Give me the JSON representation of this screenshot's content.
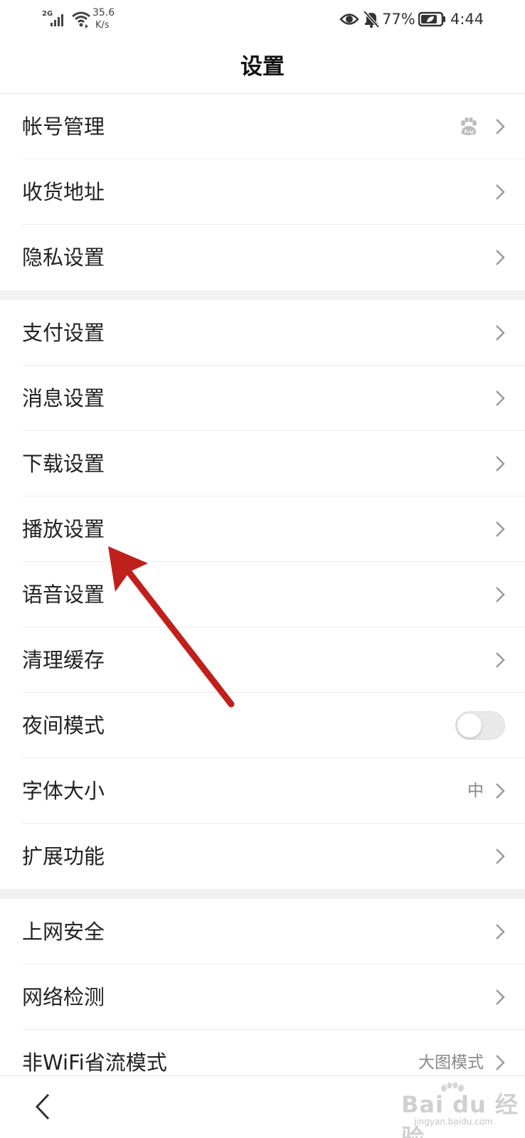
{
  "status_bar": {
    "network": "2G",
    "speed_value": "35.6",
    "speed_unit": "K/s",
    "battery_percent": "77%",
    "time": "4:44"
  },
  "header": {
    "title": "设置"
  },
  "groups": [
    {
      "items": [
        {
          "label": "帐号管理",
          "badge_icon": "baidu-paw-icon",
          "chevron": true
        },
        {
          "label": "收货地址",
          "chevron": true
        },
        {
          "label": "隐私设置",
          "chevron": true
        }
      ]
    },
    {
      "items": [
        {
          "label": "支付设置",
          "chevron": true
        },
        {
          "label": "消息设置",
          "chevron": true
        },
        {
          "label": "下载设置",
          "chevron": true
        },
        {
          "label": "播放设置",
          "chevron": true
        },
        {
          "label": "语音设置",
          "chevron": true
        },
        {
          "label": "清理缓存",
          "chevron": true
        },
        {
          "label": "夜间模式",
          "toggle": true,
          "toggle_on": false
        },
        {
          "label": "字体大小",
          "value": "中",
          "chevron": true
        },
        {
          "label": "扩展功能",
          "chevron": true
        }
      ]
    },
    {
      "items": [
        {
          "label": "上网安全",
          "chevron": true
        },
        {
          "label": "网络检测",
          "chevron": true
        },
        {
          "label": "非WiFi省流模式",
          "value": "大图模式",
          "chevron": true
        }
      ]
    }
  ],
  "bottom_bar": {
    "back_icon": "chevron-left-icon"
  },
  "annotation": {
    "color": "#c0201c",
    "points_to": "播放设置"
  },
  "watermark": {
    "text": "Bai du 经验",
    "sub": "jingyan.baidu.com"
  },
  "colors": {
    "background": "#ffffff",
    "group_gap": "#f2f2f2",
    "divider": "#eeeeee",
    "label": "#222222",
    "secondary": "#888888",
    "chevron": "#999999"
  }
}
